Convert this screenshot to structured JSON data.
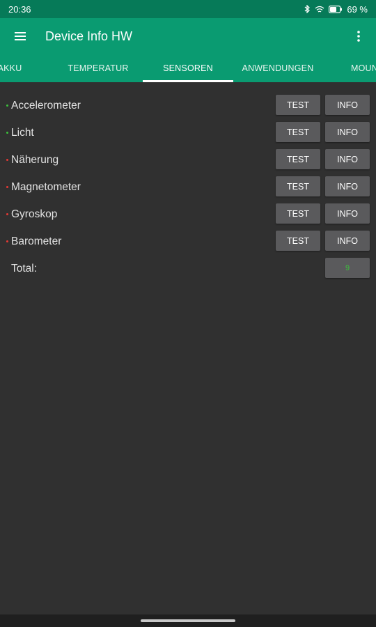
{
  "status_bar": {
    "time": "20:36",
    "battery_percent": "69 %",
    "battery_level": 0.69,
    "icons": [
      "bluetooth-icon",
      "wifi-icon",
      "battery-icon"
    ]
  },
  "app_bar": {
    "title": "Device Info HW",
    "menu_icon": "hamburger-menu-icon",
    "overflow_icon": "more-vert-icon"
  },
  "tabs": [
    {
      "label": "AKKU"
    },
    {
      "label": "TEMPERATUR"
    },
    {
      "label": "SENSOREN",
      "active": true
    },
    {
      "label": "ANWENDUNGEN"
    },
    {
      "label": "MOUN"
    }
  ],
  "sensors": [
    {
      "name": "Accelerometer",
      "status_color": "#3cc13c",
      "test_label": "TEST",
      "info_label": "INFO"
    },
    {
      "name": "Licht",
      "status_color": "#3cc13c",
      "test_label": "TEST",
      "info_label": "INFO"
    },
    {
      "name": "Näherung",
      "status_color": "#e53935",
      "test_label": "TEST",
      "info_label": "INFO"
    },
    {
      "name": "Magnetometer",
      "status_color": "#e53935",
      "test_label": "TEST",
      "info_label": "INFO"
    },
    {
      "name": "Gyroskop",
      "status_color": "#e53935",
      "test_label": "TEST",
      "info_label": "INFO"
    },
    {
      "name": "Barometer",
      "status_color": "#e53935",
      "test_label": "TEST",
      "info_label": "INFO"
    }
  ],
  "total": {
    "label": "Total:",
    "value": "9"
  },
  "colors": {
    "status_bar": "#067a58",
    "app_bar": "#0a9b71",
    "background": "#303030",
    "button": "#5a5a5c",
    "ok": "#3cc13c",
    "fail": "#e53935"
  }
}
